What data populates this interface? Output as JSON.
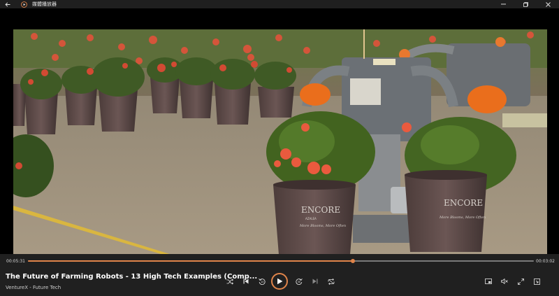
{
  "app": {
    "title": "媒體播放器"
  },
  "playback": {
    "current_time": "00:05:31",
    "duration": "00:03:02",
    "progress": 0.642
  },
  "media": {
    "title": "The Future of Farming Robots - 13 High Tech Examples (Comp...",
    "subtitle": "VentureX - Future Tech",
    "video_text": {
      "pot_brand": "ENCORE",
      "pot_brand_sub": "AZALEA",
      "pot_slogan": "More Blooms, More Often"
    }
  },
  "icons": {
    "back": "back-arrow-icon",
    "logo": "media-player-logo-icon",
    "minimize": "minimize-icon",
    "restore": "restore-icon",
    "close": "close-icon",
    "shuffle": "shuffle-icon",
    "previous": "previous-track-icon",
    "rewind": "rewind-10-icon",
    "play": "play-icon",
    "forward": "forward-30-icon",
    "next": "next-track-icon",
    "repeat": "repeat-icon",
    "miniplayer": "miniplayer-icon",
    "volume": "volume-muted-icon",
    "fullscreen": "fullscreen-icon",
    "more": "more-icon"
  },
  "colors": {
    "accent": "#e0844a",
    "bar_bg": "#202020",
    "titlebar_bg": "#1f1f1f"
  }
}
